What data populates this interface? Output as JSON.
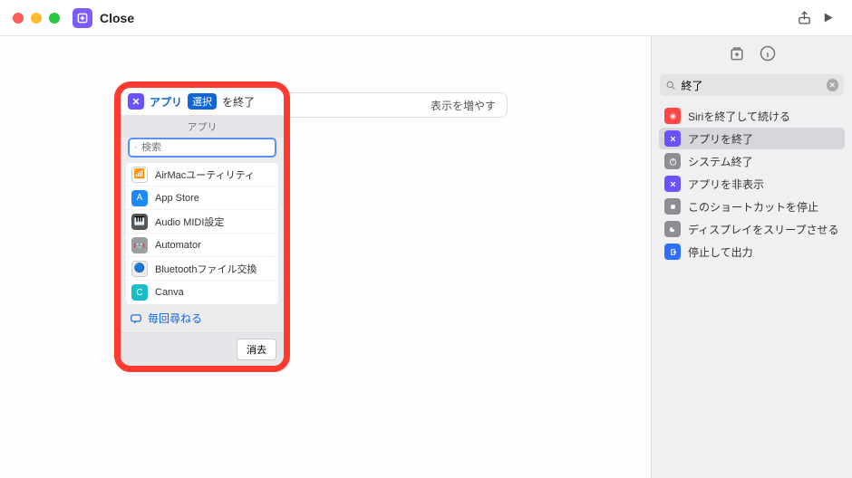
{
  "titlebar": {
    "title": "Close"
  },
  "canvas": {
    "show_more": "表示を増やす"
  },
  "popover": {
    "app_label": "アプリ",
    "select_pill": "選択",
    "end_label": "を終了",
    "section_label": "アプリ",
    "search_placeholder": "検索",
    "ask_each_time": "毎回尋ねる",
    "clear": "消去",
    "apps": [
      {
        "name": "AirMacユーティリティ",
        "bg": "#ffffff",
        "bd": "#ccc",
        "glyph": "📶"
      },
      {
        "name": "App Store",
        "bg": "#1e88ff",
        "glyph": "A"
      },
      {
        "name": "Audio MIDI設定",
        "bg": "#555",
        "glyph": "🎹"
      },
      {
        "name": "Automator",
        "bg": "#9e9e9e",
        "glyph": "🤖"
      },
      {
        "name": "Bluetoothファイル交換",
        "bg": "#eee",
        "bd": "#ccc",
        "glyph": "🔵"
      },
      {
        "name": "Canva",
        "bg": "#17bdc9",
        "glyph": "C"
      }
    ]
  },
  "sidebar": {
    "search_value": "終了",
    "items": [
      {
        "label": "Siriを終了して続ける",
        "bg": "#ff4444",
        "sel": false,
        "glyph": "siri"
      },
      {
        "label": "アプリを終了",
        "bg": "#6a52ff",
        "sel": true,
        "glyph": "x"
      },
      {
        "label": "システム終了",
        "bg": "#8e8e92",
        "sel": false,
        "glyph": "power"
      },
      {
        "label": "アプリを非表示",
        "bg": "#6a52ff",
        "sel": false,
        "glyph": "x"
      },
      {
        "label": "このショートカットを停止",
        "bg": "#8e8e92",
        "sel": false,
        "glyph": "stop"
      },
      {
        "label": "ディスプレイをスリープさせる",
        "bg": "#8e8e92",
        "sel": false,
        "glyph": "moon"
      },
      {
        "label": "停止して出力",
        "bg": "#2f6fff",
        "sel": false,
        "glyph": "out"
      }
    ]
  }
}
